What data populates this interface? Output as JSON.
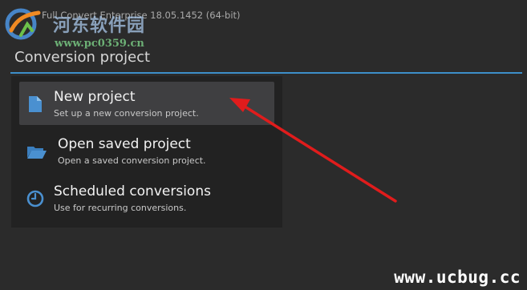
{
  "window": {
    "title": "Full Convert Enterprise 18.05.1452 (64-bit)"
  },
  "watermark": {
    "brand_cn": "河东软件园",
    "url": "www.pc0359.cn"
  },
  "page": {
    "section_title": "Conversion project"
  },
  "menu": {
    "items": [
      {
        "label": "New project",
        "description": "Set up a new conversion project.",
        "icon": "document-icon",
        "selected": true
      },
      {
        "label": "Open saved project",
        "description": "Open a saved conversion project.",
        "icon": "folder-open-icon",
        "selected": false
      },
      {
        "label": "Scheduled conversions",
        "description": "Use for recurring conversions.",
        "icon": "clock-icon",
        "selected": false
      }
    ]
  },
  "annotation": {
    "arrow_color": "#e01c1c"
  },
  "footer_watermark": {
    "text": "www.ucbug.cc"
  },
  "colors": {
    "background": "#2b2b2b",
    "accent": "#3d8fc9",
    "icon_blue": "#4a90d0",
    "selected_row": "#3f3f41"
  }
}
